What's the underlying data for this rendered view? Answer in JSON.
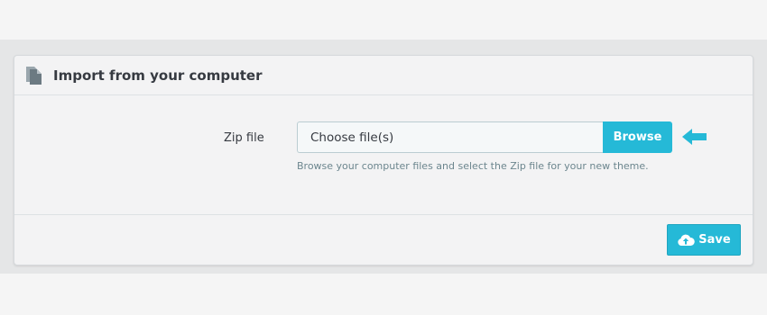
{
  "panel": {
    "title": "Import from your computer",
    "header_icon": "document-icon"
  },
  "form": {
    "label": "Zip file",
    "file_input_value": "Choose file(s)",
    "browse_label": "Browse",
    "help_text": "Browse your computer files and select the Zip file for your new theme.",
    "pointer_icon": "arrow-left-icon"
  },
  "footer": {
    "save_label": "Save",
    "save_icon": "cloud-upload-icon"
  },
  "colors": {
    "accent": "#25b9d7",
    "panel_background": "#f3f3f4",
    "page_background": "#f5f5f5",
    "band_background": "#e5e6e7",
    "text": "#363a41",
    "help_text": "#6c868e"
  }
}
